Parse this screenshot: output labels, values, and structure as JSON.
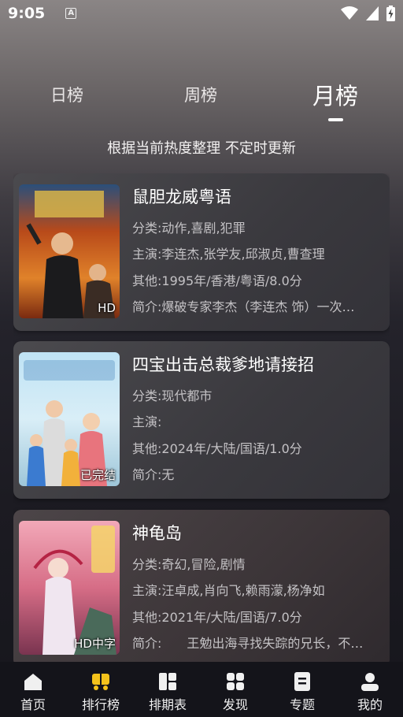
{
  "status": {
    "time": "9:05",
    "a_badge": "A"
  },
  "tabs": [
    {
      "label": "日榜",
      "active": false
    },
    {
      "label": "周榜",
      "active": false
    },
    {
      "label": "月榜",
      "active": true
    }
  ],
  "subtitle": "根据当前热度整理 不定时更新",
  "labels": {
    "category": "分类:",
    "cast": "主演:",
    "other": "其他:",
    "intro": "简介:"
  },
  "cards": [
    {
      "title": "鼠胆龙威粤语",
      "badge": "HD",
      "category": "动作,喜剧,犯罪",
      "cast": "李连杰,张学友,邱淑贞,曹查理",
      "other": "1995年/香港/粤语/8.0分",
      "intro": "爆破专家李杰（李连杰 饰）一次…"
    },
    {
      "title": "四宝出击总裁爹地请接招",
      "badge": "已完结",
      "category": "现代都市",
      "cast": "",
      "other": "2024年/大陆/国语/1.0分",
      "intro": "无"
    },
    {
      "title": "神龟岛",
      "badge": "HD中字",
      "category": "奇幻,冒险,剧情",
      "cast": "汪卓成,肖向飞,赖雨濛,杨净如",
      "other": "2021年/大陆/国语/7.0分",
      "intro": "　　王勉出海寻找失踪的兄长，不…"
    }
  ],
  "nav": [
    {
      "label": "首页",
      "icon": "home-icon",
      "active": false
    },
    {
      "label": "排行榜",
      "icon": "ranking-icon",
      "active": true
    },
    {
      "label": "排期表",
      "icon": "schedule-icon",
      "active": false
    },
    {
      "label": "发现",
      "icon": "discover-icon",
      "active": false
    },
    {
      "label": "专题",
      "icon": "topic-icon",
      "active": false
    },
    {
      "label": "我的",
      "icon": "profile-icon",
      "active": false
    }
  ],
  "colors": {
    "accent": "#f4c21b",
    "card_bg": "#3c3b40",
    "nav_bg": "#14141a"
  }
}
